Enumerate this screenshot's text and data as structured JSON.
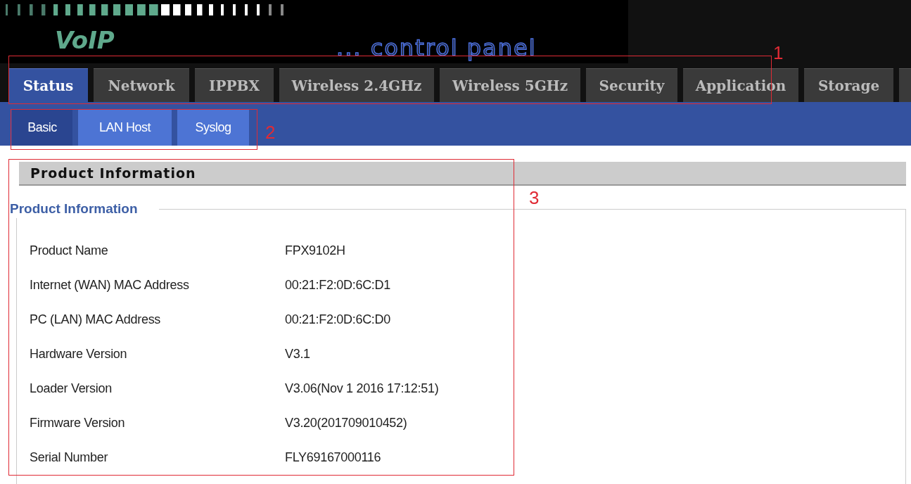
{
  "logo": {
    "brand": "VoIP",
    "tagline": "... control panel"
  },
  "tabs": [
    {
      "label": "Status",
      "selected": true
    },
    {
      "label": "Network",
      "selected": false
    },
    {
      "label": "IPPBX",
      "selected": false
    },
    {
      "label": "Wireless 2.4GHz",
      "selected": false
    },
    {
      "label": "Wireless 5GHz",
      "selected": false
    },
    {
      "label": "Security",
      "selected": false
    },
    {
      "label": "Application",
      "selected": false
    },
    {
      "label": "Storage",
      "selected": false
    }
  ],
  "subtabs": [
    {
      "label": "Basic",
      "selected": true
    },
    {
      "label": "LAN Host",
      "selected": false
    },
    {
      "label": "Syslog",
      "selected": false
    }
  ],
  "section_title": "Product Information",
  "fieldset": {
    "legend": "Product Information",
    "rows": [
      {
        "label": "Product Name",
        "value": "FPX9102H"
      },
      {
        "label": "Internet (WAN) MAC Address",
        "value": "00:21:F2:0D:6C:D1"
      },
      {
        "label": "PC (LAN) MAC Address",
        "value": "00:21:F2:0D:6C:D0"
      },
      {
        "label": "Hardware Version",
        "value": "V3.1"
      },
      {
        "label": "Loader Version",
        "value": "V3.06(Nov 1 2016 17:12:51)"
      },
      {
        "label": "Firmware Version",
        "value": "V3.20(201709010452)"
      },
      {
        "label": "Serial Number",
        "value": "FLY69167000116"
      }
    ]
  },
  "annotations": [
    "1",
    "2",
    "3"
  ]
}
